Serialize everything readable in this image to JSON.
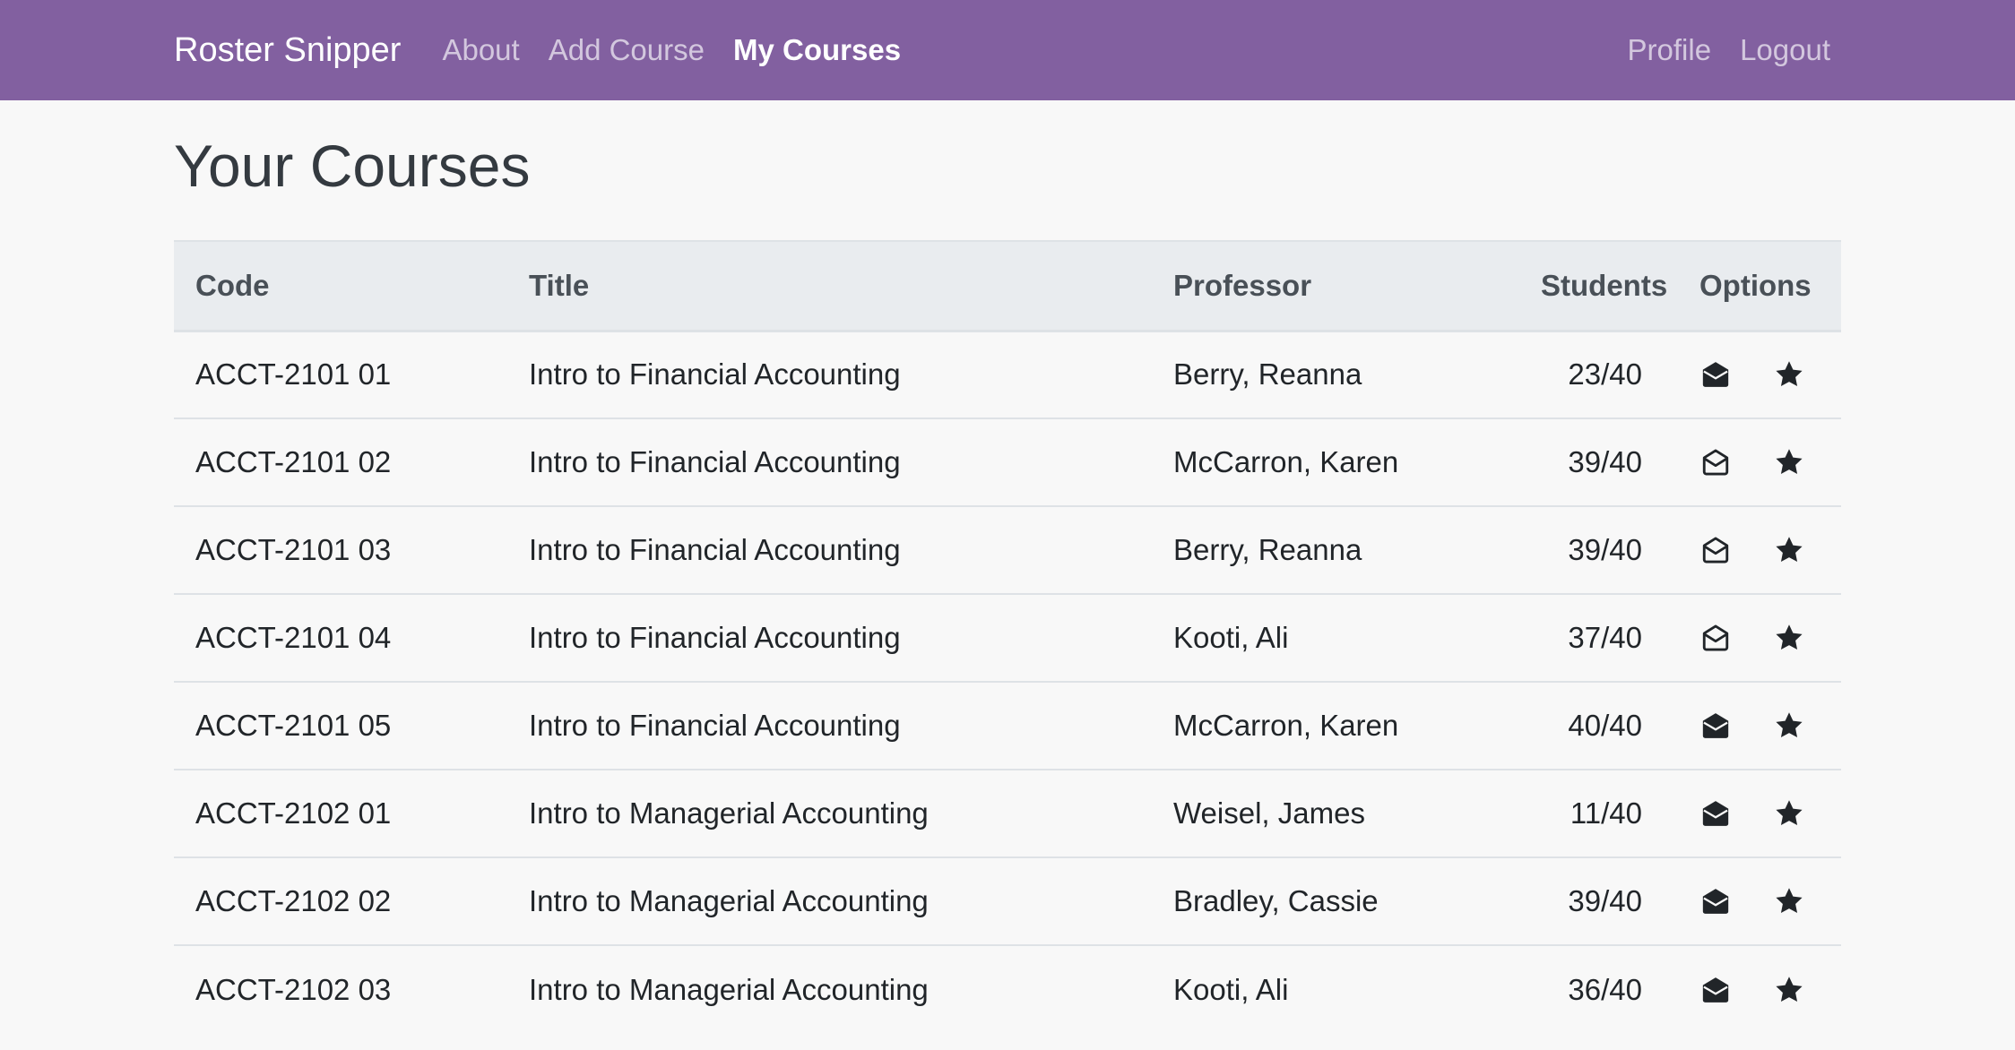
{
  "navbar": {
    "brand": "Roster Snipper",
    "links": [
      "About",
      "Add Course",
      "My Courses"
    ],
    "active_link": "My Courses",
    "right_links": [
      "Profile",
      "Logout"
    ],
    "color": "#8260a0"
  },
  "page": {
    "title": "Your Courses"
  },
  "table": {
    "headers": {
      "code": "Code",
      "title": "Title",
      "professor": "Professor",
      "students": "Students",
      "options": "Options"
    },
    "rows": [
      {
        "code": "ACCT-2101 01",
        "title": "Intro to Financial Accounting",
        "professor": "Berry, Reanna",
        "students": "23/40",
        "mail_icon": "envelope-filled-icon"
      },
      {
        "code": "ACCT-2101 02",
        "title": "Intro to Financial Accounting",
        "professor": "McCarron, Karen",
        "students": "39/40",
        "mail_icon": "envelope-open-outline-icon"
      },
      {
        "code": "ACCT-2101 03",
        "title": "Intro to Financial Accounting",
        "professor": "Berry, Reanna",
        "students": "39/40",
        "mail_icon": "envelope-open-outline-icon"
      },
      {
        "code": "ACCT-2101 04",
        "title": "Intro to Financial Accounting",
        "professor": "Kooti, Ali",
        "students": "37/40",
        "mail_icon": "envelope-open-outline-icon"
      },
      {
        "code": "ACCT-2101 05",
        "title": "Intro to Financial Accounting",
        "professor": "McCarron, Karen",
        "students": "40/40",
        "mail_icon": "envelope-filled-icon"
      },
      {
        "code": "ACCT-2102 01",
        "title": "Intro to Managerial Accounting",
        "professor": "Weisel, James",
        "students": "11/40",
        "mail_icon": "envelope-filled-icon"
      },
      {
        "code": "ACCT-2102 02",
        "title": "Intro to Managerial Accounting",
        "professor": "Bradley, Cassie",
        "students": "39/40",
        "mail_icon": "envelope-filled-icon"
      },
      {
        "code": "ACCT-2102 03",
        "title": "Intro to Managerial Accounting",
        "professor": "Kooti, Ali",
        "students": "36/40",
        "mail_icon": "envelope-filled-icon"
      }
    ],
    "star_icon": "star-icon"
  }
}
